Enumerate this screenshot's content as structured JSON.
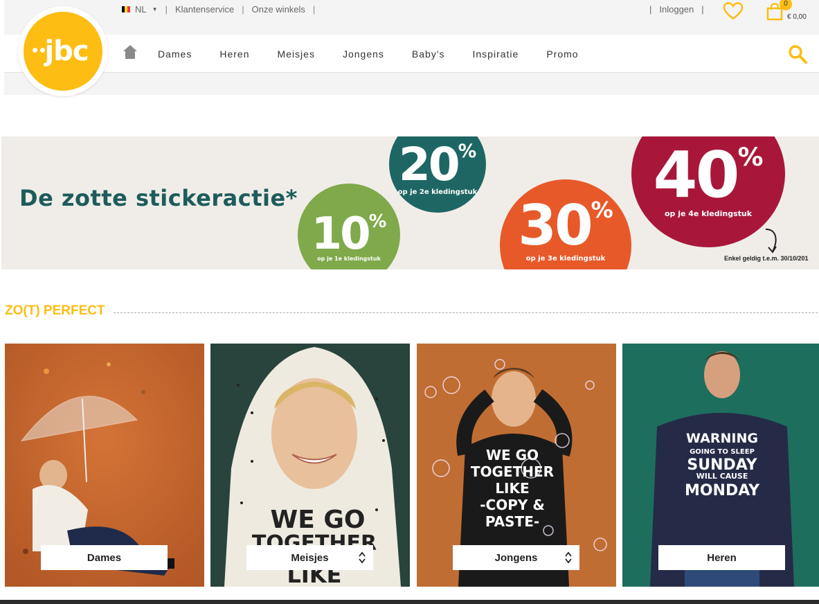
{
  "header": {
    "logo_text": "jbc",
    "language": "NL",
    "top_links": [
      "Klantenservice",
      "Onze winkels"
    ],
    "login": "Inloggen",
    "cart_count": "0",
    "cart_total": "€ 0,00",
    "nav": [
      "Dames",
      "Heren",
      "Meisjes",
      "Jongens",
      "Baby's",
      "Inspiratie",
      "Promo"
    ]
  },
  "banner": {
    "title": "De zotte stickeractie*",
    "discounts": [
      {
        "value": "10",
        "label": "op je 1e kledingstuk",
        "color": "#7fa94a"
      },
      {
        "value": "20",
        "label": "op je 2e kledingstuk",
        "color": "#1e6664"
      },
      {
        "value": "30",
        "label": "op je 3e kledingstuk",
        "color": "#e8592a"
      },
      {
        "value": "40",
        "label": "op je 4e kledingstuk",
        "color": "#a8173a"
      }
    ],
    "percent_sign": "%",
    "validity": "Enkel geldig t.e.m. 30/10/201"
  },
  "section": {
    "title": "ZO(T) PERFECT",
    "cards": [
      {
        "label": "Dames",
        "image": "woman-with-umbrella",
        "bg": "#c8672e"
      },
      {
        "label": "Meisjes",
        "image": "girl-in-hoodie",
        "bg": "#28443c"
      },
      {
        "label": "Jongens",
        "image": "boy-with-bubbles",
        "bg": "#c06d33"
      },
      {
        "label": "Heren",
        "image": "man-in-sweater",
        "bg": "#1e6e5e"
      }
    ],
    "shirt_texts": {
      "girl": "WE GO TOGETHER LIKE",
      "boy": "WE GO TOGETHER LIKE -COPY & PASTE-",
      "man": "WARNING GOING TO SLEEP SUNDAY WILL CAUSE MONDAY"
    }
  },
  "colors": {
    "brand": "#fdbd12",
    "text": "#333333"
  }
}
